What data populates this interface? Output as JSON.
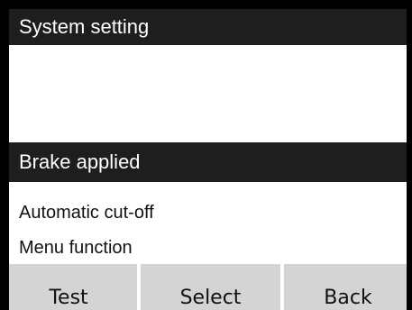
{
  "header": {
    "title": "System setting"
  },
  "menu": {
    "items": [
      {
        "label": "Brake applied",
        "selected": true
      },
      {
        "label": "Automatic cut-off",
        "selected": false
      },
      {
        "label": "Menu function",
        "selected": false
      }
    ]
  },
  "softkeys": [
    {
      "label": "Test"
    },
    {
      "label": "Select"
    },
    {
      "label": "Back"
    }
  ],
  "colors": {
    "title_background": "#1e1e1e",
    "selected_background": "#1e1e1e",
    "softkey_background": "#d4d4d4",
    "frame": "#000000"
  }
}
